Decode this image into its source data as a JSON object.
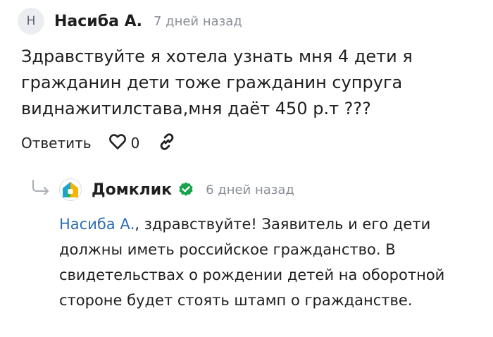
{
  "comment": {
    "avatar_initial": "Н",
    "author": "Насиба А.",
    "time": "7 дней назад",
    "text": "Здравствуйте я хотела узнать мня 4 дети я гражданин дети тоже гражданин супруга виднажитилстава,мня даёт 450 р.т ???",
    "actions": {
      "reply_label": "Ответить",
      "like_icon": "heart-icon",
      "like_count": "0",
      "link_icon": "link-icon"
    }
  },
  "reply": {
    "author": "Домклик",
    "brand_logo": "domclick-logo",
    "verified_icon": "verified-badge-icon",
    "time": "6 дней назад",
    "mention": "Насиба А.",
    "text": ", здравствуйте! Заявитель и его дети должны иметь российское гражданство. В свидетельствах о рождении детей на оборотной стороне будет стоять штамп о гражданстве."
  },
  "colors": {
    "mention": "#2f6fb2",
    "verified": "#16a34a",
    "muted": "#8a8f96",
    "avatar_bg": "#ebedf0"
  }
}
